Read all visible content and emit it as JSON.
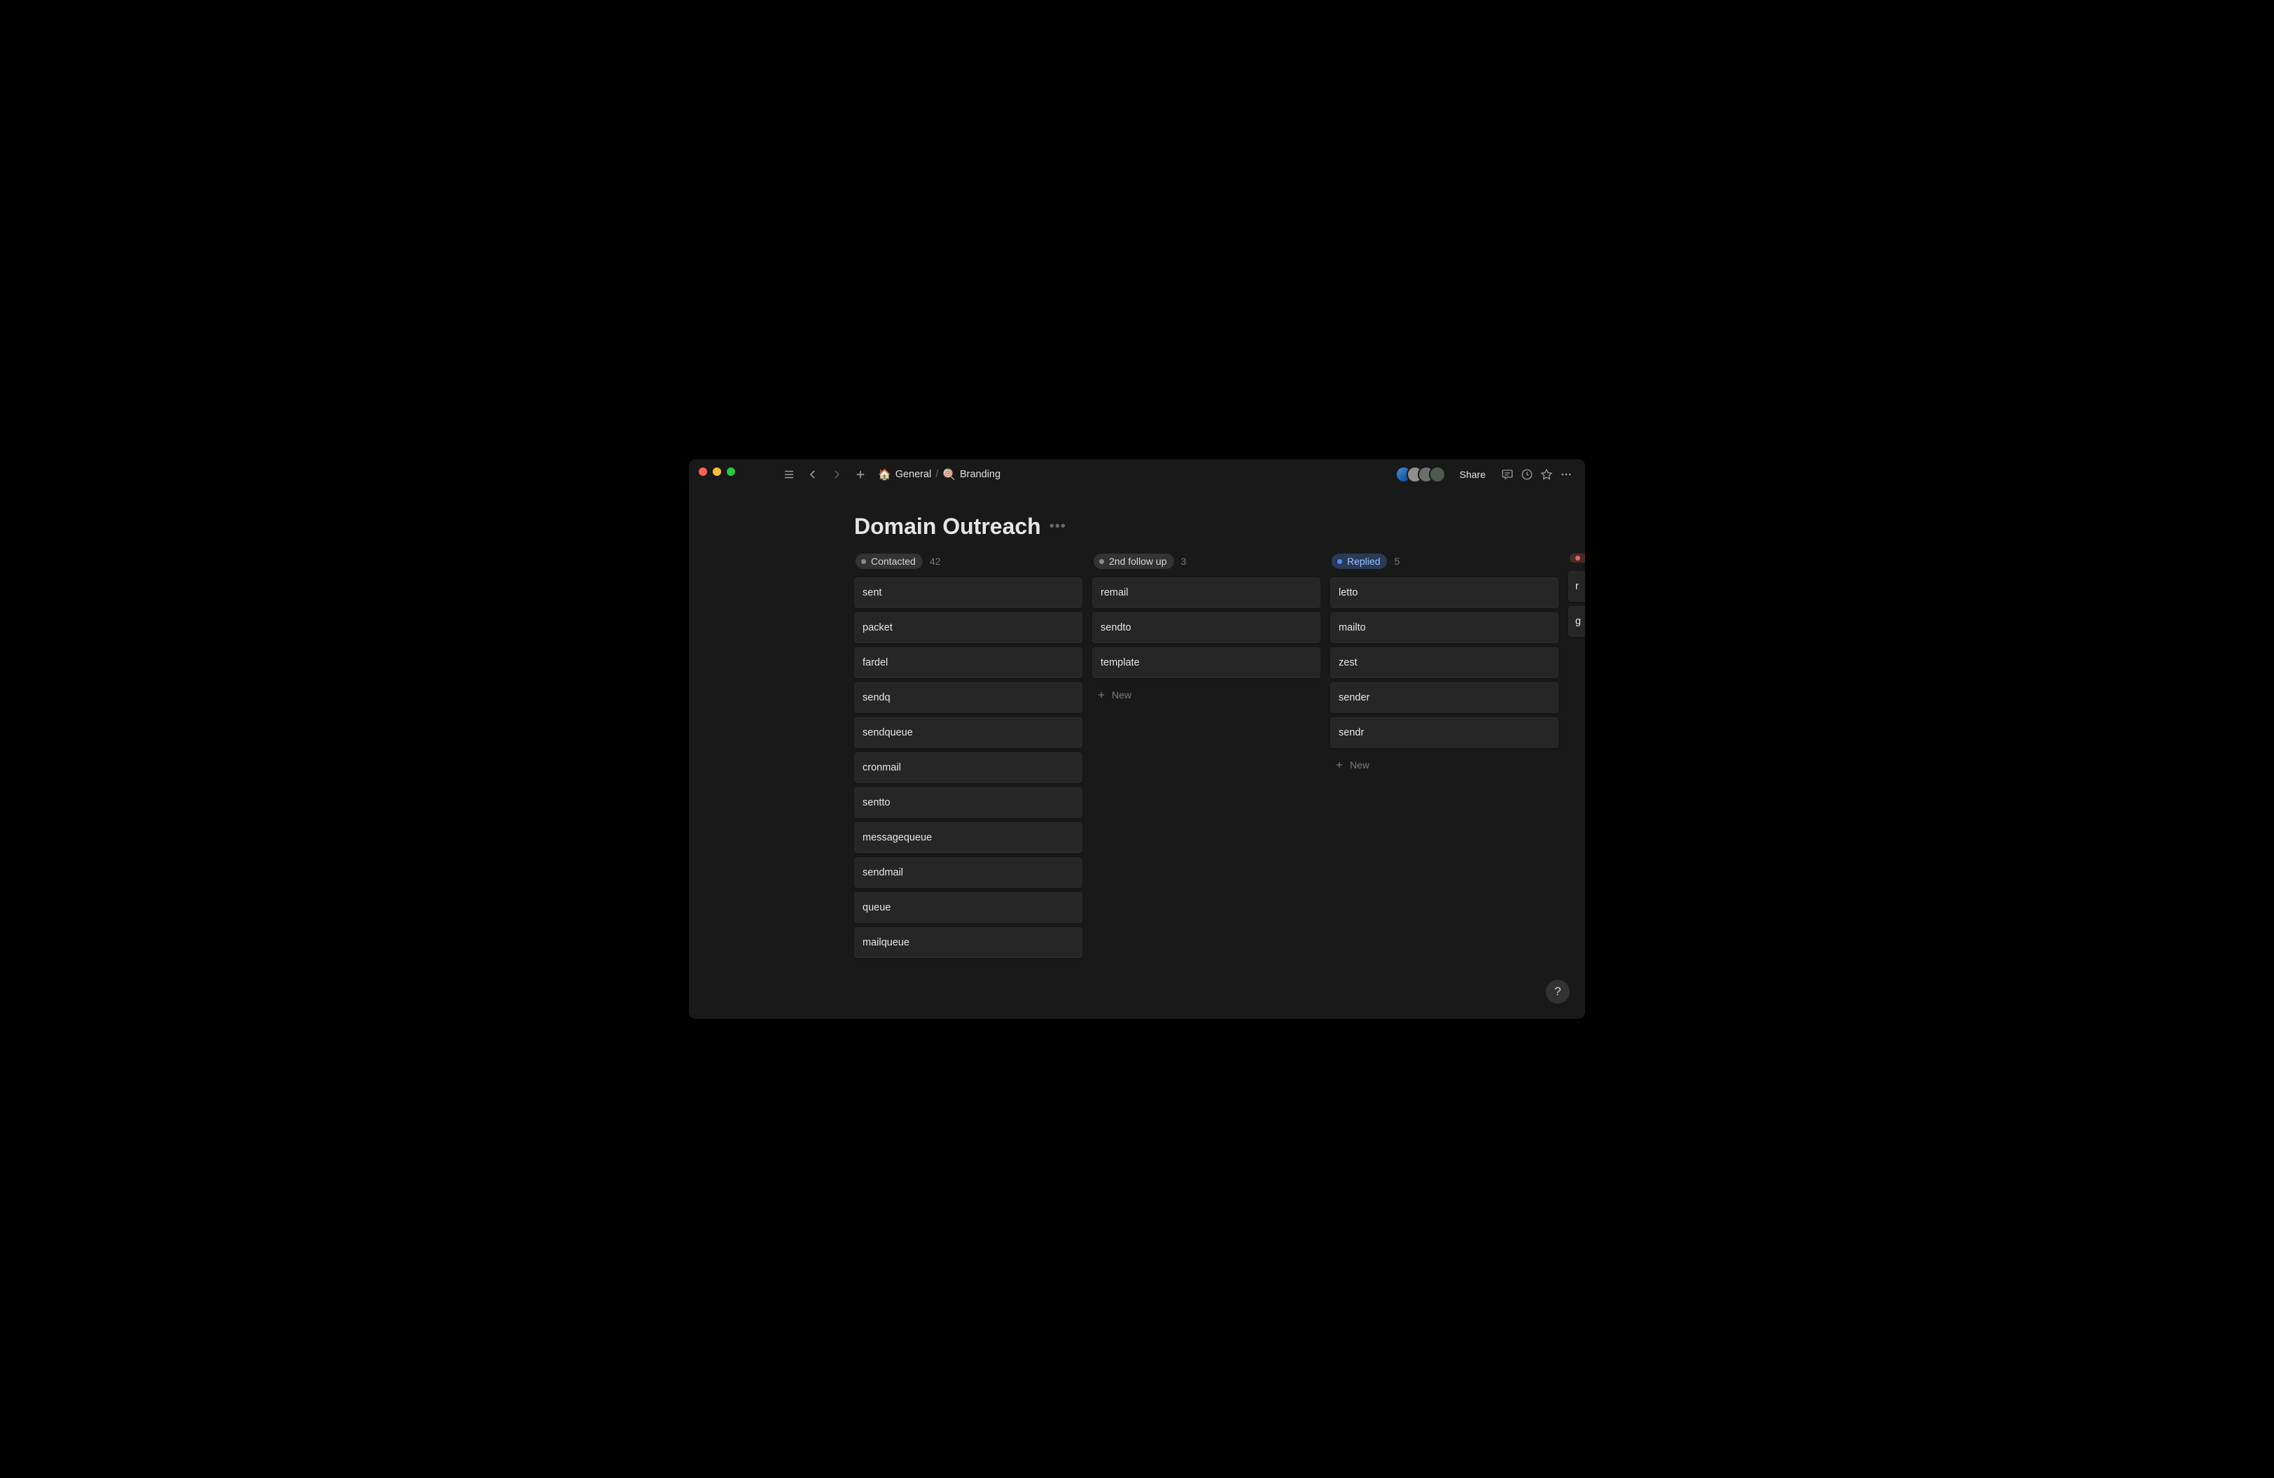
{
  "breadcrumb": {
    "root_icon": "🏠",
    "root_label": "General",
    "page_icon": "🍭",
    "page_label": "Branding"
  },
  "header": {
    "share_label": "Share"
  },
  "page": {
    "title": "Domain Outreach"
  },
  "board": {
    "new_label": "New",
    "columns": [
      {
        "id": "contacted",
        "label": "Contacted",
        "count": "42",
        "tag_style": "gray",
        "cards": [
          "sent",
          "packet",
          "fardel",
          "sendq",
          "sendqueue",
          "cronmail",
          "sentto",
          "messagequeue",
          "sendmail",
          "queue",
          "mailqueue"
        ]
      },
      {
        "id": "2nd-follow-up",
        "label": "2nd follow up",
        "count": "3",
        "tag_style": "gray",
        "cards": [
          "remail",
          "sendto",
          "template"
        ]
      },
      {
        "id": "replied",
        "label": "Replied",
        "count": "5",
        "tag_style": "blue",
        "cards": [
          "letto",
          "mailto",
          "zest",
          "sender",
          "sendr"
        ]
      },
      {
        "id": "partial-next",
        "label": "",
        "count": "",
        "tag_style": "red",
        "cards": [
          "r",
          "g"
        ]
      }
    ]
  },
  "help_label": "?"
}
